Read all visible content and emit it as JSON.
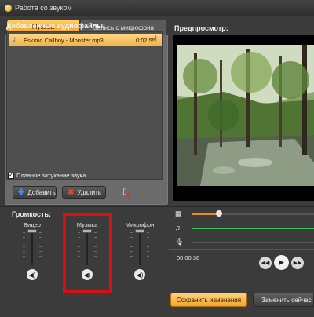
{
  "window": {
    "title": "Работа со звуком"
  },
  "tabs": [
    {
      "label": "Музыка",
      "active": true
    },
    {
      "label": "Запись с микрофона",
      "active": false
    }
  ],
  "files": {
    "title": "Добавленные аудиофайлы:",
    "items": [
      {
        "name": "Eskimo Callboy - Monster.mp3",
        "duration": "0:02:55",
        "icon": "music-note-icon"
      }
    ]
  },
  "fade": {
    "label": "Плавное затухание звука",
    "checked": true
  },
  "file_buttons": {
    "add_label": "Добавить",
    "remove_label": "Удалить"
  },
  "preview": {
    "label": "Предпросмотр:"
  },
  "volume": {
    "title": "Громкость:",
    "channels": [
      {
        "label": "Видео"
      },
      {
        "label": "Музыка"
      },
      {
        "label": "Микрофон"
      }
    ]
  },
  "player": {
    "timecode": "00:00:36"
  },
  "actions": {
    "save_label": "Сохранить изменения",
    "replace_label": "Заменить сейчас"
  },
  "colors": {
    "accent": "#f2a42c",
    "highlight": "#d81010",
    "music_track": "#39c452",
    "video_track": "#e98b2a"
  }
}
